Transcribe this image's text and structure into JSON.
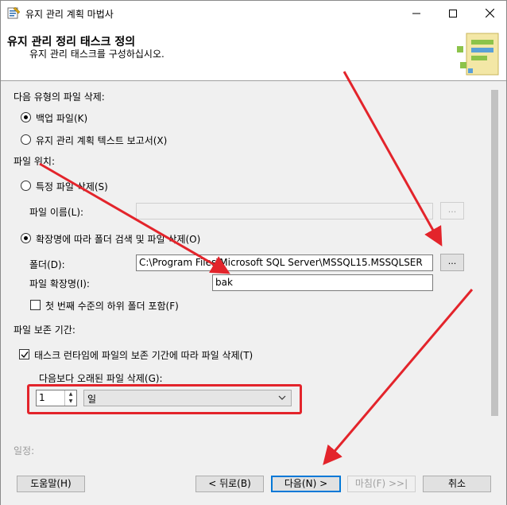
{
  "window": {
    "title": "유지 관리 계획 마법사"
  },
  "header": {
    "title": "유지 관리 정리 태스크 정의",
    "subtitle": "유지 관리 태스크를 구성하십시오."
  },
  "delete_type": {
    "label": "다음 유형의 파일 삭제:",
    "options": [
      {
        "label": "백업 파일(K)",
        "selected": true
      },
      {
        "label": "유지 관리 계획 텍스트 보고서(X)",
        "selected": false
      }
    ]
  },
  "file_location": {
    "label": "파일 위치:",
    "specific_file_option": "특정 파일 삭제(S)",
    "file_name_label": "파일 이름(L):",
    "file_name_value": "",
    "browse_label": "...",
    "search_folder_option": "확장명에 따라 폴더 검색 및 파일 삭제(O)",
    "folder_label": "폴더(D):",
    "folder_value": "C:\\Program Files\\Microsoft SQL Server\\MSSQL15.MSSQLSER",
    "extension_label": "파일 확장명(I):",
    "extension_value": "bak",
    "include_subfolders_label": "첫 번째 수준의 하위 폴더 포함(F)",
    "include_subfolders_checked": false
  },
  "file_age": {
    "label": "파일 보존 기간:",
    "delete_by_age_label": "태스크 런타임에 파일의 보존 기간에 따라 파일 삭제(T)",
    "delete_by_age_checked": true,
    "older_than_label": "다음보다 오래된 파일 삭제(G):",
    "older_than_value": "1",
    "unit_value": "일"
  },
  "schedule_label": "일정:",
  "buttons": {
    "help": "도움말(H)",
    "back": "< 뒤로(B)",
    "next": "다음(N) >",
    "finish": "마침(F) >>|",
    "cancel": "취소"
  },
  "colors": {
    "annotation_red": "#e3242b",
    "primary_border": "#0078d7"
  }
}
